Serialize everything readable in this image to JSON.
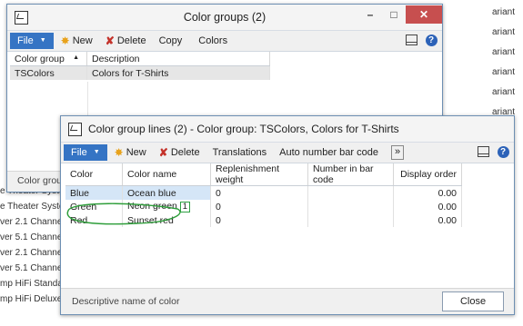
{
  "background": {
    "left_rows": [
      "e Theater Syster",
      "e Theater Syster",
      "ver 2.1 Channel",
      "ver 5.1 Channel",
      "ver 2.1 Channel",
      "ver 5.1 Channel",
      "mp HiFi Standar",
      "mp HiFi Deluxe"
    ],
    "right_rows": [
      "ariant",
      "ariant",
      "ariant",
      "ariant",
      "ariant",
      "ariant",
      "ariant"
    ]
  },
  "color_groups_window": {
    "title": "Color groups (2)",
    "buttons": {
      "minimize": "–",
      "maximize": "□",
      "close": "✕"
    },
    "toolbar": {
      "file": "File",
      "new": "New",
      "delete": "Delete",
      "copy": "Copy",
      "colors": "Colors"
    },
    "columns": [
      "Color group",
      "Description"
    ],
    "rows": [
      {
        "group": "TSColors",
        "description": "Colors for T-Shirts"
      }
    ],
    "status_text": "Color grou"
  },
  "lines_window": {
    "title": "Color group lines (2) - Color group: TSColors, Colors for T-Shirts",
    "toolbar": {
      "file": "File",
      "new": "New",
      "delete": "Delete",
      "translations": "Translations",
      "auto_number": "Auto number bar code",
      "more": "»"
    },
    "columns": [
      "Color",
      "Color name",
      "Replenishment weight",
      "Number in bar code",
      "Display order"
    ],
    "rows": [
      {
        "color": "Blue",
        "name": "Ocean blue",
        "weight": "0",
        "barcode": "",
        "order": "0.00"
      },
      {
        "color": "Green",
        "name": "Neon green",
        "weight": "0",
        "barcode": "",
        "order": "0.00"
      },
      {
        "color": "Red",
        "name": "Sunset red",
        "weight": "0",
        "barcode": "",
        "order": "0.00"
      }
    ],
    "annotation": "1",
    "status_text": "Descriptive name of color",
    "close_label": "Close"
  }
}
